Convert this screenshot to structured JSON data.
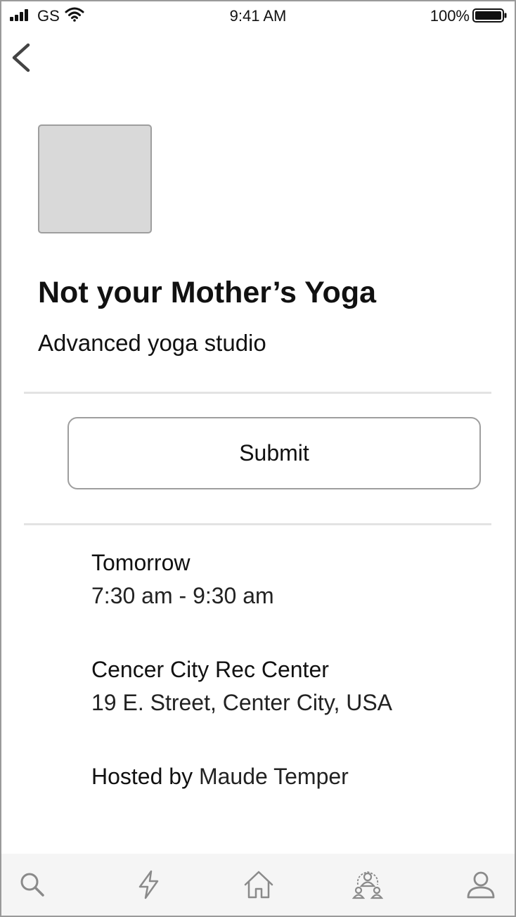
{
  "status_bar": {
    "carrier": "GS",
    "time": "9:41 AM",
    "battery_percent": "100%",
    "icons": [
      "signal-bars-icon",
      "wifi-icon",
      "battery-icon"
    ]
  },
  "navigation": {
    "back_icon": "chevron-left-icon"
  },
  "event": {
    "title": "Not your Mother’s Yoga",
    "subtitle": "Advanced yoga studio",
    "submit_label": "Submit",
    "time_label": "Tomorrow",
    "time_range": "7:30 am - 9:30 am",
    "location_name": "Cencer City Rec Center",
    "location_address": "19 E. Street, Center City, USA",
    "host_label": "Hosted by",
    "host_name": "Maude Temper"
  },
  "tab_bar": {
    "tabs": [
      {
        "icon": "search-icon"
      },
      {
        "icon": "lightning-icon"
      },
      {
        "icon": "home-icon"
      },
      {
        "icon": "group-icon"
      },
      {
        "icon": "profile-icon"
      }
    ]
  },
  "colors": {
    "text": "#111111",
    "placeholder": "#d9d9d9",
    "border": "#9e9e9e",
    "divider": "#e3e3e3",
    "tab_bar_bg": "#f5f5f5",
    "icon": "#8a8a8a"
  }
}
